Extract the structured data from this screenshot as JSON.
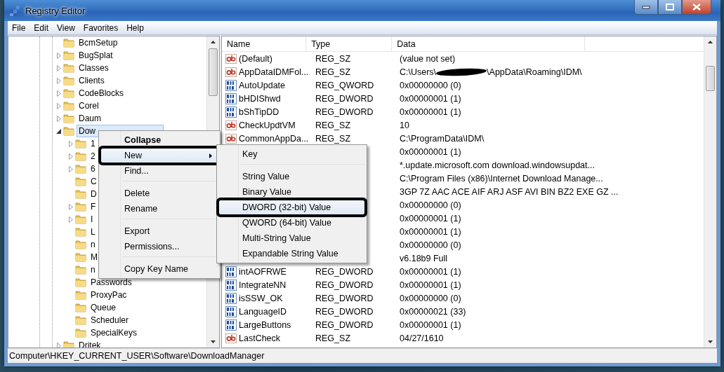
{
  "window": {
    "title": "Registry Editor"
  },
  "menu_bar": [
    "File",
    "Edit",
    "View",
    "Favorites",
    "Help"
  ],
  "tree": {
    "items": [
      {
        "label": "BcmSetup",
        "expandable": false,
        "expanded": false,
        "selected": false
      },
      {
        "label": "BugSplat",
        "expandable": true,
        "expanded": false,
        "selected": false
      },
      {
        "label": "Classes",
        "expandable": true,
        "expanded": false,
        "selected": false
      },
      {
        "label": "Clients",
        "expandable": true,
        "expanded": false,
        "selected": false
      },
      {
        "label": "CodeBlocks",
        "expandable": true,
        "expanded": false,
        "selected": false
      },
      {
        "label": "Corel",
        "expandable": true,
        "expanded": false,
        "selected": false
      },
      {
        "label": "Daum",
        "expandable": true,
        "expanded": false,
        "selected": false
      },
      {
        "label": "Dow",
        "expandable": true,
        "expanded": true,
        "selected": true,
        "children": [
          {
            "label": "1",
            "expandable": true,
            "expanded": false,
            "selected": false
          },
          {
            "label": "2",
            "expandable": true,
            "expanded": false,
            "selected": false
          },
          {
            "label": "6",
            "expandable": true,
            "expanded": false,
            "selected": false
          },
          {
            "label": "C",
            "expandable": false,
            "expanded": false,
            "selected": false
          },
          {
            "label": "D",
            "expandable": false,
            "expanded": false,
            "selected": false
          },
          {
            "label": "F",
            "expandable": true,
            "expanded": false,
            "selected": false
          },
          {
            "label": "I",
            "expandable": true,
            "expanded": false,
            "selected": false
          },
          {
            "label": "L",
            "expandable": false,
            "expanded": false,
            "selected": false
          },
          {
            "label": "n",
            "expandable": false,
            "expanded": false,
            "selected": false
          },
          {
            "label": "M",
            "expandable": false,
            "expanded": false,
            "selected": false
          },
          {
            "label": "n",
            "expandable": false,
            "expanded": false,
            "selected": false
          },
          {
            "label": "Passwords",
            "expandable": false,
            "expanded": false,
            "selected": false
          },
          {
            "label": "ProxyPac",
            "expandable": false,
            "expanded": false,
            "selected": false
          },
          {
            "label": "Queue",
            "expandable": false,
            "expanded": false,
            "selected": false
          },
          {
            "label": "Scheduler",
            "expandable": false,
            "expanded": false,
            "selected": false
          },
          {
            "label": "SpecialKeys",
            "expandable": false,
            "expanded": false,
            "selected": false
          }
        ]
      },
      {
        "label": "Dritek",
        "expandable": true,
        "expanded": false,
        "selected": false
      }
    ]
  },
  "values": {
    "columns": [
      "Name",
      "Type",
      "Data"
    ],
    "rows": [
      {
        "kind": "string",
        "name": "(Default)",
        "type": "REG_SZ",
        "data": "(value not set)"
      },
      {
        "kind": "string",
        "name": "AppDataIDMFol...",
        "type": "REG_SZ",
        "data": "C:\\Users\\",
        "redacted": true,
        "data_after": "\\AppData\\Roaming\\IDM\\"
      },
      {
        "kind": "binary",
        "name": "AutoUpdate",
        "type": "REG_QWORD",
        "data": "0x00000000 (0)"
      },
      {
        "kind": "binary",
        "name": "bHDIShwd",
        "type": "REG_DWORD",
        "data": "0x00000001 (1)"
      },
      {
        "kind": "binary",
        "name": "bShTipDD",
        "type": "REG_DWORD",
        "data": "0x00000001 (1)"
      },
      {
        "kind": "string",
        "name": "CheckUpdtVM",
        "type": "REG_SZ",
        "data": "10"
      },
      {
        "kind": "string",
        "name": "CommonAppDa...",
        "type": "REG_SZ",
        "data": "C:\\ProgramData\\IDM\\"
      },
      {
        "data": "0x00000001 (1)"
      },
      {
        "data": "*.update.microsoft.com download.windowsupdat..."
      },
      {
        "data": "C:\\Program Files (x86)\\Internet Download Manage..."
      },
      {
        "data": "3GP 7Z AAC ACE AIF ARJ ASF AVI BIN BZ2 EXE GZ ..."
      },
      {
        "data": "0x00000000 (0)"
      },
      {
        "data": "0x00000001 (1)"
      },
      {
        "data": "0x00000001 (1)"
      },
      {
        "data": "0x00000000 (0)"
      },
      {
        "data": "v6.18b9 Full"
      },
      {
        "kind": "binary",
        "name": "intAOFRWE",
        "type": "REG_DWORD",
        "data": "0x00000001 (1)"
      },
      {
        "kind": "binary",
        "name": "IntegrateNN",
        "type": "REG_DWORD",
        "data": "0x00000001 (1)"
      },
      {
        "kind": "binary",
        "name": "isSSW_OK",
        "type": "REG_DWORD",
        "data": "0x00000000 (0)"
      },
      {
        "kind": "binary",
        "name": "LanguageID",
        "type": "REG_DWORD",
        "data": "0x00000021 (33)"
      },
      {
        "kind": "binary",
        "name": "LargeButtons",
        "type": "REG_DWORD",
        "data": "0x00000001 (1)"
      },
      {
        "kind": "string",
        "name": "LastCheck",
        "type": "REG_SZ",
        "data": "04/27/1610"
      }
    ]
  },
  "context_menu": {
    "items": [
      {
        "kind": "default",
        "label": "Collapse",
        "highlighted": false,
        "annotated": false
      },
      {
        "kind": "submenu",
        "label": "New",
        "highlighted": true,
        "annotated": true
      },
      {
        "kind": "item",
        "label": "Find...",
        "highlighted": false,
        "annotated": false
      },
      {
        "kind": "separator"
      },
      {
        "kind": "item",
        "label": "Delete",
        "highlighted": false,
        "annotated": false
      },
      {
        "kind": "item",
        "label": "Rename",
        "highlighted": false,
        "annotated": false
      },
      {
        "kind": "separator"
      },
      {
        "kind": "item",
        "label": "Export",
        "highlighted": false,
        "annotated": false
      },
      {
        "kind": "item",
        "label": "Permissions...",
        "highlighted": false,
        "annotated": false
      },
      {
        "kind": "separator"
      },
      {
        "kind": "item",
        "label": "Copy Key Name",
        "highlighted": false,
        "annotated": false
      }
    ]
  },
  "submenu": {
    "items": [
      {
        "kind": "item",
        "label": "Key",
        "highlighted": false,
        "annotated": false
      },
      {
        "kind": "separator"
      },
      {
        "kind": "item",
        "label": "String Value",
        "highlighted": false,
        "annotated": false
      },
      {
        "kind": "item",
        "label": "Binary Value",
        "highlighted": false,
        "annotated": false
      },
      {
        "kind": "item",
        "label": "DWORD (32-bit) Value",
        "highlighted": true,
        "annotated": true
      },
      {
        "kind": "item",
        "label": "QWORD (64-bit) Value",
        "highlighted": false,
        "annotated": false
      },
      {
        "kind": "item",
        "label": "Multi-String Value",
        "highlighted": false,
        "annotated": false
      },
      {
        "kind": "item",
        "label": "Expandable String Value",
        "highlighted": false,
        "annotated": false
      }
    ]
  },
  "status_bar": {
    "path": "Computer\\HKEY_CURRENT_USER\\Software\\DownloadManager"
  }
}
